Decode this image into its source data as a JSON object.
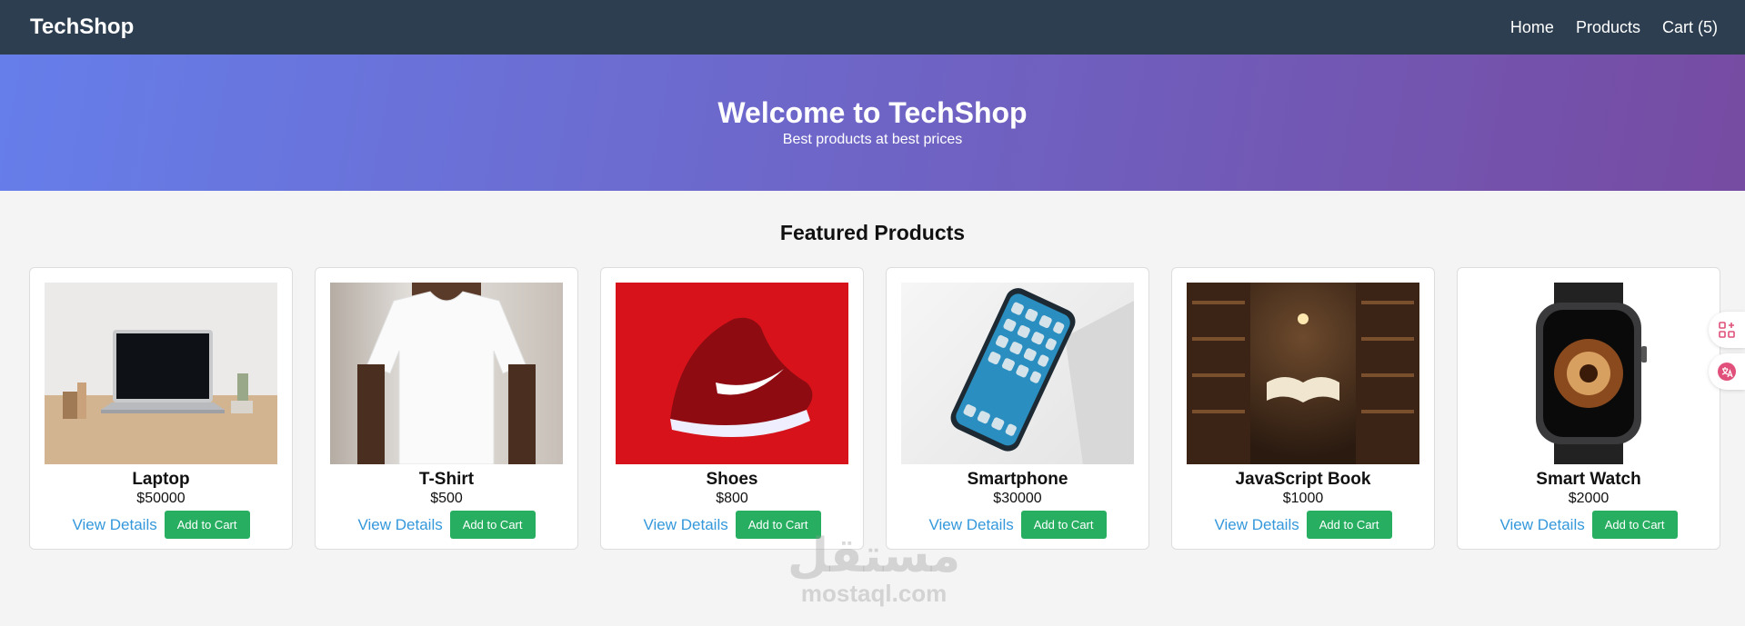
{
  "navbar": {
    "brand": "TechShop",
    "links": [
      "Home",
      "Products",
      "Cart (5)"
    ]
  },
  "hero": {
    "title": "Welcome to TechShop",
    "subtitle": "Best products at best prices"
  },
  "section_title": "Featured Products",
  "products": [
    {
      "name": "Laptop",
      "price": "$50000",
      "view_label": "View Details",
      "cart_label": "Add to Cart",
      "image": "laptop-photo"
    },
    {
      "name": "T-Shirt",
      "price": "$500",
      "view_label": "View Details",
      "cart_label": "Add to Cart",
      "image": "tshirt-photo"
    },
    {
      "name": "Shoes",
      "price": "$800",
      "view_label": "View Details",
      "cart_label": "Add to Cart",
      "image": "shoes-photo"
    },
    {
      "name": "Smartphone",
      "price": "$30000",
      "view_label": "View Details",
      "cart_label": "Add to Cart",
      "image": "smartphone-photo"
    },
    {
      "name": "JavaScript Book",
      "price": "$1000",
      "view_label": "View Details",
      "cart_label": "Add to Cart",
      "image": "book-photo"
    },
    {
      "name": "Smart Watch",
      "price": "$2000",
      "view_label": "View Details",
      "cart_label": "Add to Cart",
      "image": "watch-photo"
    }
  ],
  "watermark": {
    "arabic": "مستقل",
    "latin": "mostaql.com"
  },
  "colors": {
    "navbar": "#2c3e50",
    "hero_start": "#667eea",
    "hero_end": "#764ba2",
    "link": "#3498db",
    "button": "#27ae60"
  },
  "icons": [
    "grid-add-icon",
    "translate-icon"
  ]
}
